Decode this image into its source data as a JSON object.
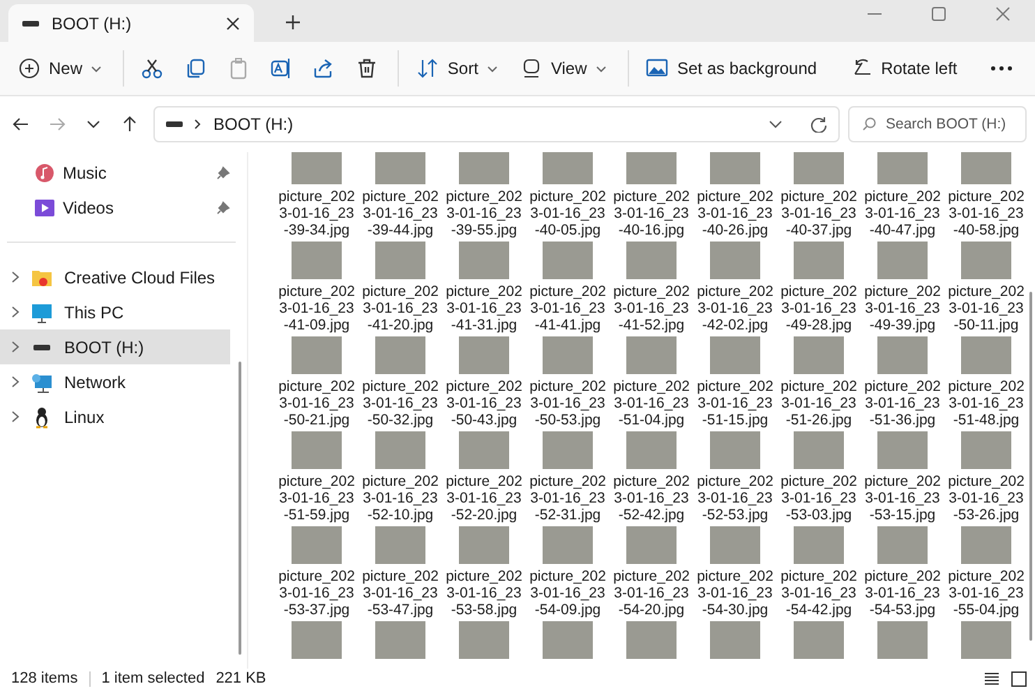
{
  "window": {
    "tab_title": "BOOT (H:)"
  },
  "toolbar": [
    {
      "kind": "menu",
      "label": "New"
    },
    {
      "kind": "icon",
      "disabled": false,
      "separator_before": true
    },
    {
      "kind": "icon",
      "disabled": false
    },
    {
      "kind": "icon",
      "disabled": true
    },
    {
      "kind": "icon",
      "disabled": false
    },
    {
      "kind": "icon",
      "disabled": false
    },
    {
      "kind": "icon",
      "disabled": false
    },
    {
      "kind": "menu",
      "label": "Sort",
      "separator_before": true
    },
    {
      "kind": "menu",
      "label": "View"
    },
    {
      "kind": "text",
      "label": "Set as background",
      "separator_before": true
    },
    {
      "kind": "text",
      "label": "Rotate left"
    },
    {
      "kind": "more"
    }
  ],
  "address": {
    "path": "BOOT (H:)",
    "search_placeholder": "Search BOOT (H:)",
    "forward_disabled": true
  },
  "quick_access": [
    {
      "label": "Music",
      "pinned": true
    },
    {
      "label": "Videos",
      "pinned": true
    }
  ],
  "tree": [
    {
      "label": "Creative Cloud Files",
      "selected": false
    },
    {
      "label": "This PC",
      "selected": false
    },
    {
      "label": "BOOT (H:)",
      "selected": true
    },
    {
      "label": "Network",
      "selected": false
    },
    {
      "label": "Linux",
      "selected": false
    }
  ],
  "files": [
    {
      "name": "picture_2023-01-16_23-39-34.jpg",
      "selected": false
    },
    {
      "name": "picture_2023-01-16_23-39-44.jpg",
      "selected": false
    },
    {
      "name": "picture_2023-01-16_23-39-55.jpg",
      "selected": false
    },
    {
      "name": "picture_2023-01-16_23-40-05.jpg",
      "selected": false
    },
    {
      "name": "picture_2023-01-16_23-40-16.jpg",
      "selected": false
    },
    {
      "name": "picture_2023-01-16_23-40-26.jpg",
      "selected": false
    },
    {
      "name": "picture_2023-01-16_23-40-37.jpg",
      "selected": false
    },
    {
      "name": "picture_2023-01-16_23-40-47.jpg",
      "selected": false
    },
    {
      "name": "picture_2023-01-16_23-40-58.jpg",
      "selected": false
    },
    {
      "name": "picture_2023-01-16_23-41-09.jpg",
      "selected": false
    },
    {
      "name": "picture_2023-01-16_23-41-20.jpg",
      "selected": false
    },
    {
      "name": "picture_2023-01-16_23-41-31.jpg",
      "selected": false
    },
    {
      "name": "picture_2023-01-16_23-41-41.jpg",
      "selected": false
    },
    {
      "name": "picture_2023-01-16_23-41-52.jpg",
      "selected": false
    },
    {
      "name": "picture_2023-01-16_23-42-02.jpg",
      "selected": false
    },
    {
      "name": "picture_2023-01-16_23-49-28.jpg",
      "selected": false
    },
    {
      "name": "picture_2023-01-16_23-49-39.jpg",
      "selected": false
    },
    {
      "name": "picture_2023-01-16_23-50-11.jpg",
      "selected": false
    },
    {
      "name": "picture_2023-01-16_23-50-21.jpg",
      "selected": false
    },
    {
      "name": "picture_2023-01-16_23-50-32.jpg",
      "selected": false
    },
    {
      "name": "picture_2023-01-16_23-50-43.jpg",
      "selected": false
    },
    {
      "name": "picture_2023-01-16_23-50-53.jpg",
      "selected": false
    },
    {
      "name": "picture_2023-01-16_23-51-04.jpg",
      "selected": false
    },
    {
      "name": "picture_2023-01-16_23-51-15.jpg",
      "selected": false
    },
    {
      "name": "picture_2023-01-16_23-51-26.jpg",
      "selected": false
    },
    {
      "name": "picture_2023-01-16_23-51-36.jpg",
      "selected": false
    },
    {
      "name": "picture_2023-01-16_23-51-48.jpg",
      "selected": false
    },
    {
      "name": "picture_2023-01-16_23-51-59.jpg",
      "selected": false
    },
    {
      "name": "picture_2023-01-16_23-52-10.jpg",
      "selected": false
    },
    {
      "name": "picture_2023-01-16_23-52-20.jpg",
      "selected": false
    },
    {
      "name": "picture_2023-01-16_23-52-31.jpg",
      "selected": false
    },
    {
      "name": "picture_2023-01-16_23-52-42.jpg",
      "selected": false
    },
    {
      "name": "picture_2023-01-16_23-52-53.jpg",
      "selected": false
    },
    {
      "name": "picture_2023-01-16_23-53-03.jpg",
      "selected": false
    },
    {
      "name": "picture_2023-01-16_23-53-15.jpg",
      "selected": false
    },
    {
      "name": "picture_2023-01-16_23-53-26.jpg",
      "selected": false
    },
    {
      "name": "picture_2023-01-16_23-53-37.jpg",
      "selected": false
    },
    {
      "name": "picture_2023-01-16_23-53-47.jpg",
      "selected": false
    },
    {
      "name": "picture_2023-01-16_23-53-58.jpg",
      "selected": false
    },
    {
      "name": "picture_2023-01-16_23-54-09.jpg",
      "selected": false
    },
    {
      "name": "picture_2023-01-16_23-54-20.jpg",
      "selected": false
    },
    {
      "name": "picture_2023-01-16_23-54-30.jpg",
      "selected": false
    },
    {
      "name": "picture_2023-01-16_23-54-42.jpg",
      "selected": false
    },
    {
      "name": "picture_2023-01-16_23-54-53.jpg",
      "selected": false
    },
    {
      "name": "picture_2023-01-16_23-55-04.jpg",
      "selected": false
    },
    {
      "selected": false
    },
    {
      "selected": false
    },
    {
      "selected": false
    },
    {
      "selected": false
    },
    {
      "selected": false
    },
    {
      "selected": false
    },
    {
      "selected": false
    },
    {
      "selected": false
    },
    {
      "selected": false
    }
  ],
  "status": {
    "item_count": "128 items",
    "selection": "1 item selected",
    "size": "221 KB"
  }
}
